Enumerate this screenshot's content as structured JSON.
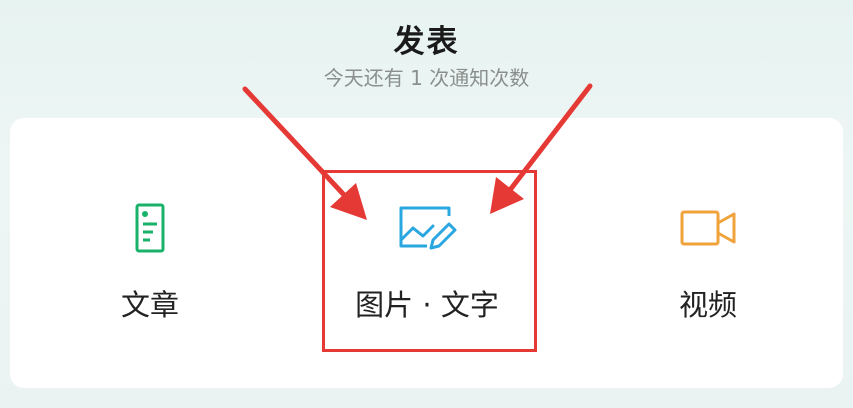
{
  "header": {
    "title": "发表",
    "subtitle": "今天还有 1 次通知次数"
  },
  "options": [
    {
      "label": "文章",
      "icon": "article-document-icon",
      "color": "#19b26b"
    },
    {
      "label": "图片 · 文字",
      "icon": "image-text-icon",
      "color": "#2aa7e0"
    },
    {
      "label": "视频",
      "icon": "video-camera-icon",
      "color": "#f0a23b"
    }
  ],
  "annotation": {
    "highlight_color": "#e53935",
    "highlighted_option": "图片 · 文字"
  }
}
